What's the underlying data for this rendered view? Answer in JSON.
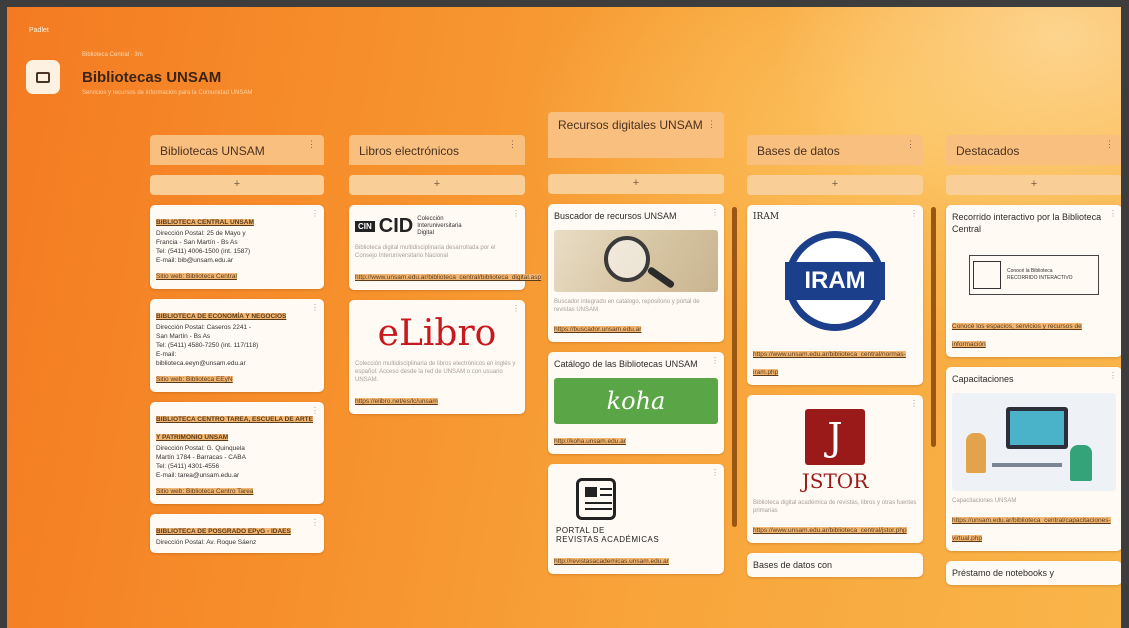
{
  "board": {
    "label": "Padlet",
    "breadcrumb": "Biblioteca Central · 3m",
    "title": "Bibliotecas UNSAM",
    "subtitle": "Servicios y recursos de información para la Comunidad UNSAM"
  },
  "columns": [
    {
      "header": "Bibliotecas UNSAM",
      "add": "+",
      "cards": [
        {
          "title": "BIBLIOTECA CENTRAL UNSAM",
          "lines": [
            "Dirección Postal: 25 de Mayo y",
            "Francia - San Martín - Bs As",
            "Tel: (5411) 4006-1500 (int. 1587)",
            "E-mail: bib@unsam.edu.ar"
          ],
          "link": "Sitio web: Biblioteca Central"
        },
        {
          "title": "BIBLIOTECA DE ECONOMÍA Y NEGOCIOS",
          "lines": [
            "Dirección Postal: Caseros 2241 -",
            "San Martín - Bs As",
            "Tel: (5411) 4580-7250 (int. 117/118)",
            "E-mail:",
            "biblioteca.eeyn@unsam.edu.ar"
          ],
          "link": "Sitio web: Biblioteca EEyN"
        },
        {
          "title": "BIBLIOTECA CENTRO TAREA, ESCUELA DE ARTE Y PATRIMONIO UNSAM",
          "lines": [
            "Dirección Postal: G. Quinquela",
            "Martín 1784 - Barracas - CABA",
            "Tel: (5411) 4301-4556",
            "E-mail: tarea@unsam.edu.ar"
          ],
          "link": "Sitio web: Biblioteca Centro Tarea"
        },
        {
          "title": "BIBLIOTECA DE POSGRADO EPyG - IDAES",
          "lines": [
            "Dirección Postal: Av. Roque Sáenz"
          ],
          "link": ""
        }
      ]
    },
    {
      "header": "Libros electrónicos",
      "add": "+",
      "cards": [
        {
          "logo": "CID",
          "logo_badge": "CIN",
          "logo_caption": "Colección Interuniversitaria Digital",
          "desc": "Biblioteca digital multidisciplinaria desarrollada por el Consejo Interuniversitario Nacional",
          "link": "http://www.unsam.edu.ar/biblioteca_central/biblioteca_digital.asp"
        },
        {
          "logo": "eLibro",
          "desc": "Colección multidisciplinaria de libros electrónicos en inglés y español. Acceso desde la red de UNSAM o con usuario UNSAM.",
          "link": "https://elibro.net/es/lc/unsam"
        }
      ]
    },
    {
      "header": "Recursos digitales UNSAM",
      "add": "+",
      "cards": [
        {
          "title": "Buscador de recursos UNSAM",
          "desc": "Buscador integrado en catálogo, repositorio y portal de revistas UNSAM",
          "link": "https://buscador.unsam.edu.ar"
        },
        {
          "title": "Catálogo de las Bibliotecas UNSAM",
          "logo": "koha",
          "link": "http://koha.unsam.edu.ar"
        },
        {
          "logo_line1": "PORTAL DE",
          "logo_line2": "REVISTAS ACADÉMICAS",
          "link": "http://revistasacademicas.unsam.edu.ar"
        }
      ]
    },
    {
      "header": "Bases de datos",
      "add": "+",
      "cards": [
        {
          "title": "IRAM",
          "logo": "IRAM",
          "link": "https://www.unsam.edu.ar/biblioteca_central/normas-iram.php"
        },
        {
          "logo": "JSTOR",
          "desc": "Biblioteca digital académica de revistas, libros y otras fuentes primarias",
          "link": "https://www.unsam.edu.ar/biblioteca_central/jstor.php"
        },
        {
          "title": "Bases de datos con"
        }
      ]
    },
    {
      "header": "Destacados",
      "add": "+",
      "cards": [
        {
          "title": "Recorrido interactivo por la Biblioteca Central",
          "logo_text1": "Conocé la Biblioteca",
          "logo_text2": "RECORRIDO INTERACTIVO",
          "link": "Conocé los espacios, servicios y recursos de información"
        },
        {
          "title": "Capacitaciones",
          "desc": "Capacitaciones UNSAM",
          "link": "https://unsam.edu.ar/biblioteca_central/capacitaciones-virtual.php"
        },
        {
          "title": "Préstamo de notebooks y"
        }
      ]
    }
  ],
  "colors": {
    "accent": "#f47a22",
    "card": "#fffaf4",
    "highlight": "#f3b774",
    "koha": "#5aa545",
    "iram": "#1c3f8c",
    "jstor": "#9a1a1a"
  }
}
